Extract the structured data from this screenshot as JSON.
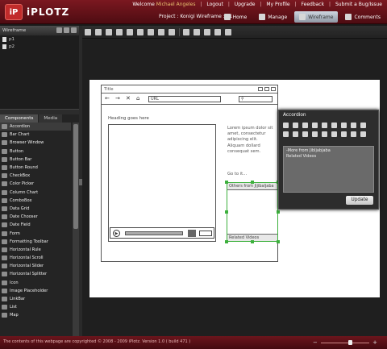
{
  "app": {
    "logo_mark": "iP",
    "logo_text": "iPLOTZ"
  },
  "topnav": {
    "welcome": "Welcome",
    "user": "Michael Angeles",
    "logout": "Logout",
    "upgrade": "Upgrade",
    "profile": "My Profile",
    "feedback": "Feedback",
    "bug": "Submit a Bug/Issue"
  },
  "project": "Project : Konigi   Wireframe : p1",
  "tabs": [
    {
      "label": "Home",
      "active": false
    },
    {
      "label": "Manage",
      "active": false
    },
    {
      "label": "Wireframe",
      "active": true
    },
    {
      "label": "Comments",
      "active": false
    }
  ],
  "wireframe_panel": {
    "title": "Wireframe",
    "items": [
      "p1",
      "p2"
    ]
  },
  "component_tabs": {
    "components": "Components",
    "media": "Media"
  },
  "components": [
    "Accordion",
    "Bar Chart",
    "Browser Window",
    "Button",
    "Button Bar",
    "Button Round",
    "CheckBox",
    "Color Picker",
    "Column Chart",
    "ComboBox",
    "Data Grid",
    "Date Chooser",
    "Date Field",
    "Form",
    "Formatting Toolbar",
    "Horizontal Rule",
    "Horizontal Scroll",
    "Horizontal Slider",
    "Horizontal Splitter",
    "Icon",
    "Image Placeholder",
    "LinkBar",
    "List",
    "Map"
  ],
  "selected_component": "Accordion",
  "sketch": {
    "title": "Title",
    "url": "URL",
    "heading": "Heading goes here",
    "lorem": "Lorem ipsum dolor sit amet, consectetur adipiscing elit. Aliquam dollard consequat sem.",
    "goto": "Go to it...",
    "acc_header": "Others from Jijibaljaba",
    "acc_footer": "Related Videos"
  },
  "accordion_panel": {
    "title": "Accordion",
    "text_line1": "-More from Jibljabjaba",
    "text_line2": "Related Videos",
    "update_label": "Update"
  },
  "footer": {
    "copyright": "The contents of this webpage are copyrighted © 2008 - 2009 iPlotz. Version 1.0 ( build 471 )"
  },
  "zoom": {
    "level": 0.62
  },
  "colors": {
    "header": "#7b1820",
    "accent_green": "#3db03d",
    "selection": "#3c3c3c"
  }
}
